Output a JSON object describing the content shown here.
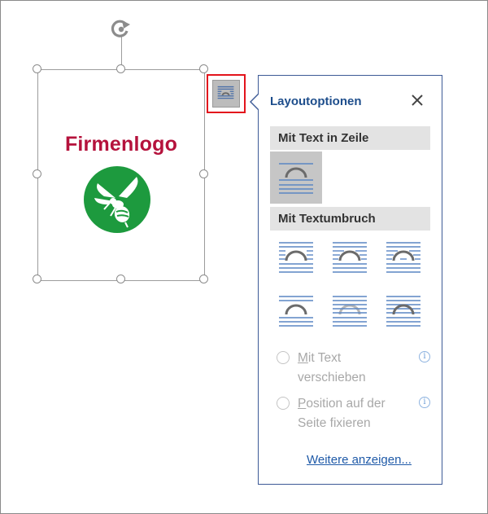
{
  "picture": {
    "title": "Firmenlogo",
    "brand_color": "#b5123c",
    "badge_color": "#1d9a3e"
  },
  "layout_button": {
    "icon": "layout-options-icon",
    "highlight_color": "#e3141c"
  },
  "panel": {
    "title": "Layoutoptionen",
    "close_icon": "close-icon",
    "section_inline": "Mit Text in Zeile",
    "section_wrap": "Mit Textumbruch",
    "inline_option": {
      "icon": "wrap-inline-icon",
      "selected": true
    },
    "wrap_options": [
      {
        "icon": "wrap-square-icon"
      },
      {
        "icon": "wrap-tight-icon"
      },
      {
        "icon": "wrap-through-icon"
      },
      {
        "icon": "wrap-top-bottom-icon"
      },
      {
        "icon": "wrap-behind-text-icon"
      },
      {
        "icon": "wrap-in-front-icon"
      }
    ],
    "radio_move": {
      "first": "M",
      "rest": "it Text",
      "line2": "verschieben"
    },
    "radio_fix": {
      "first": "P",
      "rest": "osition auf der",
      "line2": "Seite fixieren"
    },
    "info_glyph": "i",
    "more_link": "Weitere anzeigen..."
  }
}
